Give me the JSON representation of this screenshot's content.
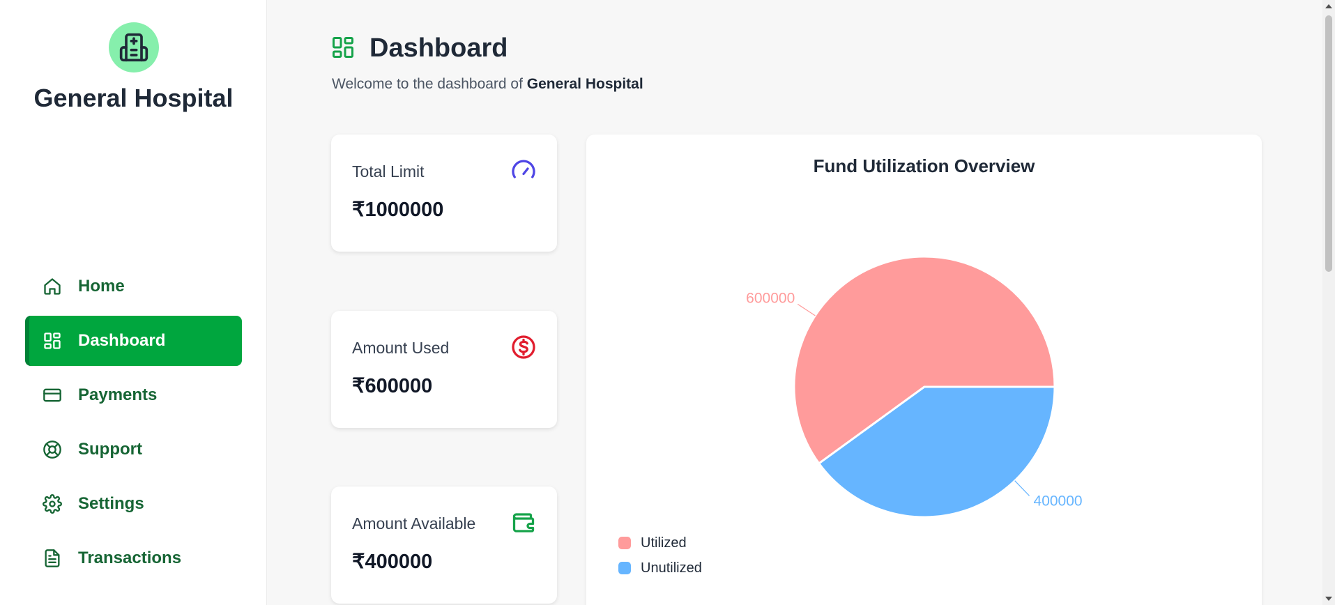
{
  "sidebar": {
    "hospital_name": "General Hospital",
    "logo_icon": "hospital-icon",
    "items": [
      {
        "label": "Home",
        "icon": "home-icon",
        "active": false
      },
      {
        "label": "Dashboard",
        "icon": "dashboard-icon",
        "active": true
      },
      {
        "label": "Payments",
        "icon": "credit-card-icon",
        "active": false
      },
      {
        "label": "Support",
        "icon": "lifebuoy-icon",
        "active": false
      },
      {
        "label": "Settings",
        "icon": "gear-icon",
        "active": false
      },
      {
        "label": "Transactions",
        "icon": "document-icon",
        "active": false
      }
    ]
  },
  "header": {
    "title": "Dashboard",
    "welcome_prefix": "Welcome to the dashboard of ",
    "welcome_name": "General Hospital"
  },
  "cards": [
    {
      "label": "Total Limit",
      "value": "₹1000000",
      "icon": "gauge-icon",
      "color": "#4f46e5"
    },
    {
      "label": "Amount Used",
      "value": "₹600000",
      "icon": "dollar-circle-icon",
      "color": "#e11d2e"
    },
    {
      "label": "Amount Available",
      "value": "₹400000",
      "icon": "wallet-icon",
      "color": "#16a34a"
    }
  ],
  "colors": {
    "brand_green": "#00a63e",
    "nav_text": "#166534",
    "utilized": "#ff9b9b",
    "unutilized": "#66b5ff"
  },
  "chart_data": {
    "type": "pie",
    "title": "Fund Utilization Overview",
    "categories": [
      "Utilized",
      "Unutilized"
    ],
    "values": [
      600000,
      400000
    ],
    "colors": [
      "#ff9b9b",
      "#66b5ff"
    ],
    "legend": "bottom-left"
  }
}
